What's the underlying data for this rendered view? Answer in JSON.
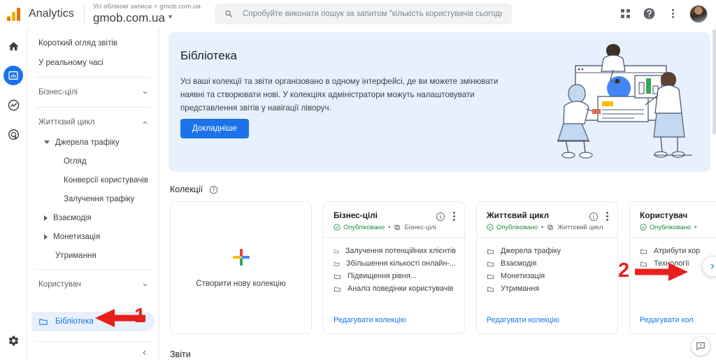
{
  "topbar": {
    "brand": "Analytics",
    "account_breadcrumb": "Усі облікові записи > gmob.com.ua",
    "property_name": "gmob.com.ua",
    "property_caret": "▾",
    "search_placeholder": "Спробуйте виконати пошук за запитом \"кількість користувачів сьогодні\"",
    "icons": {
      "search": "search-icon",
      "apps": "apps-grid-icon",
      "help": "help-icon",
      "more": "more-options-icon",
      "avatar": "user-avatar"
    }
  },
  "rail": {
    "items": [
      {
        "name": "home-icon",
        "label": "Home"
      },
      {
        "name": "reports-icon",
        "label": "Reports",
        "active": true
      },
      {
        "name": "explore-icon",
        "label": "Explore"
      },
      {
        "name": "advertising-icon",
        "label": "Advertising"
      }
    ],
    "settings": "gear-icon"
  },
  "sidebar": {
    "items": [
      {
        "label": "Короткий огляд звітів",
        "type": "item"
      },
      {
        "label": "У реальному часі",
        "type": "item"
      },
      {
        "label": "Бізнес-цілі",
        "type": "group",
        "expanded": false
      },
      {
        "label": "Життєвий цикл",
        "type": "group",
        "expanded": true
      },
      {
        "label": "Джерела трафіку",
        "type": "sub",
        "expanded": true
      },
      {
        "label": "Огляд",
        "type": "leaf"
      },
      {
        "label": "Конверсії користувачів",
        "type": "leaf"
      },
      {
        "label": "Залучення трафіку",
        "type": "leaf"
      },
      {
        "label": "Взаємодія",
        "type": "sub",
        "expanded": false
      },
      {
        "label": "Монетизація",
        "type": "sub",
        "expanded": false
      },
      {
        "label": "Утримання",
        "type": "leaf-plain"
      },
      {
        "label": "Користувач",
        "type": "group",
        "expanded": false
      }
    ],
    "library": {
      "label": "Бібліотека",
      "icon": "folder-icon"
    },
    "collapse": "chevron-left-icon"
  },
  "hero": {
    "title": "Бібліотека",
    "body": "Усі ваші колекції та звіти організовано в одному інтерфейсі, де ви можете змінювати наявні та створювати нові. У колекціях адміністратори можуть налаштовувати представлення звітів у навігації ліворуч.",
    "button": "Докладніше",
    "illustration": "people-with-charts-illustration",
    "bg_color": "#e8f0fe",
    "button_color": "#1a73e8"
  },
  "collections": {
    "heading": "Колекції",
    "help_icon": "help-circle-icon",
    "create_card": {
      "label": "Створити нову колекцію",
      "icon": "plus-icon"
    },
    "published_label": "Опубліковано",
    "edit_label": "Редагувати колекцію",
    "published_color": "#1e8e3e",
    "cards": [
      {
        "title": "Бізнес-цілі",
        "status": "Опубліковано",
        "nav_label": "Бізнес-цілі",
        "items": [
          "Залучення потенційних клієнтів",
          "Збільшення кількості онлайн-...",
          "Підвищення рівня...",
          "Аналіз поведінки користувачів"
        ],
        "edit": "Редагувати колекцію"
      },
      {
        "title": "Життєвий цикл",
        "status": "Опубліковано",
        "nav_label": "Життєвий цикл",
        "items": [
          "Джерела трафіку",
          "Взаємодія",
          "Монетизація",
          "Утримання"
        ],
        "edit": "Редагувати колекцію"
      },
      {
        "title": "Користувач",
        "status": "Опубліковано",
        "nav_label": "",
        "items": [
          "Атрибути кор",
          "Технології"
        ],
        "edit": "Редагувати кол"
      }
    ],
    "next_button": "chevron-right-icon"
  },
  "reports": {
    "heading": "Звіти"
  },
  "feedback_button": "feedback-icon",
  "annotations": [
    {
      "number": "1",
      "target": "Бібліотека",
      "color": "#e8201a"
    },
    {
      "number": "2",
      "target": "next-collection-arrow",
      "color": "#e8201a"
    }
  ]
}
